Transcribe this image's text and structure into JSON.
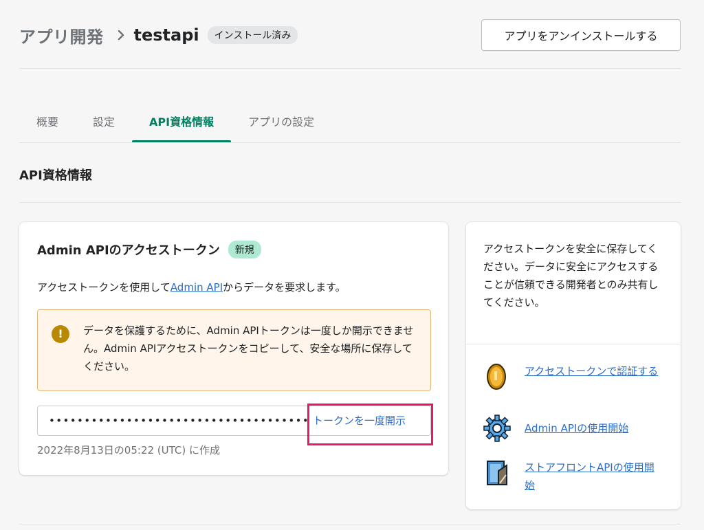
{
  "header": {
    "breadcrumb_parent": "アプリ開発",
    "app_name": "testapi",
    "status_badge": "インストール済み",
    "uninstall_label": "アプリをアンインストールする"
  },
  "tabs": [
    {
      "label": "概要"
    },
    {
      "label": "設定"
    },
    {
      "label": "API資格情報"
    },
    {
      "label": "アプリの設定"
    }
  ],
  "section_title": "API資格情報",
  "admin_token_card": {
    "title": "Admin APIのアクセストークン",
    "badge": "新規",
    "desc_before": "アクセストークンを使用して",
    "desc_link": "Admin API",
    "desc_after": "からデータを要求します。",
    "warning": "データを保護するために、Admin APIトークンは一度しか開示できません。Admin APIアクセストークンをコピーして、安全な場所に保存してください。",
    "token_masked": "•••••••••••••••••••••••••••••••••••••",
    "reveal_label": "トークンを一度開示",
    "created": "2022年8月13日の05:22 (UTC) に作成"
  },
  "side_card": {
    "note": "アクセストークンを安全に保存してください。データに安全にアクセスすることが信頼できる開発者とのみ共有してください。",
    "links": [
      {
        "label": "アクセストークンで認証する",
        "icon": "coin-icon"
      },
      {
        "label": "Admin APIの使用開始",
        "icon": "gear-icon"
      },
      {
        "label": "ストアフロントAPIの使用開始",
        "icon": "building-icon"
      }
    ]
  },
  "colors": {
    "accent": "#008060",
    "link": "#2c6ecb",
    "highlight": "#e6186c",
    "warning_bg": "#fff5ea"
  }
}
